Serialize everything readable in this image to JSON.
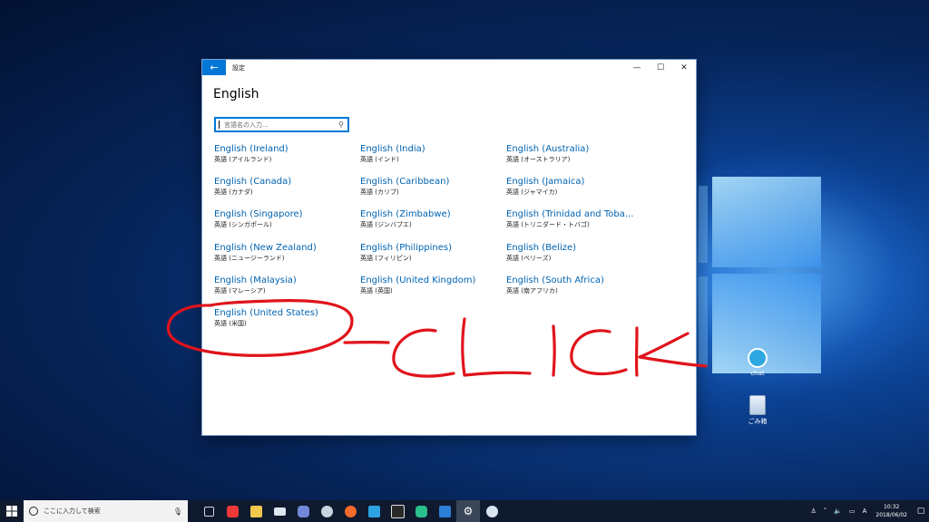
{
  "window": {
    "app_title": "設定",
    "page_title": "English",
    "back_icon": "←",
    "minimize_icon": "—",
    "maximize_icon": "☐",
    "close_icon": "✕"
  },
  "search": {
    "placeholder": "言語名の入力..."
  },
  "languages": [
    {
      "name": "English (Ireland)",
      "native": "英語 (アイルランド)"
    },
    {
      "name": "English (India)",
      "native": "英語 (インド)"
    },
    {
      "name": "English (Australia)",
      "native": "英語 (オーストラリア)"
    },
    {
      "name": "English (Canada)",
      "native": "英語 (カナダ)"
    },
    {
      "name": "English (Caribbean)",
      "native": "英語 (カリブ)"
    },
    {
      "name": "English (Jamaica)",
      "native": "英語 (ジャマイカ)"
    },
    {
      "name": "English (Singapore)",
      "native": "英語 (シンガポール)"
    },
    {
      "name": "English (Zimbabwe)",
      "native": "英語 (ジンバブエ)"
    },
    {
      "name": "English (Trinidad and Toba...",
      "native": "英語 (トリニダード・トバゴ)"
    },
    {
      "name": "English (New Zealand)",
      "native": "英語 (ニュージーランド)"
    },
    {
      "name": "English (Philippines)",
      "native": "英語 (フィリピン)"
    },
    {
      "name": "English (Belize)",
      "native": "英語 (ベリーズ)"
    },
    {
      "name": "English (Malaysia)",
      "native": "英語 (マレーシア)"
    },
    {
      "name": "English (United Kingdom)",
      "native": "英語 (英国)"
    },
    {
      "name": "English (South Africa)",
      "native": "英語 (南アフリカ)"
    },
    {
      "name": "English (United States)",
      "native": "英語 (米国)"
    }
  ],
  "annotation": {
    "color": "#e0131b",
    "text": "-CLICK"
  },
  "desktop": {
    "icons": [
      {
        "label": "chat",
        "icon": "chat-bubble-icon"
      },
      {
        "label": "ごみ箱",
        "icon": "recycle-bin-icon"
      }
    ]
  },
  "taskbar": {
    "search_placeholder": "ここに入力して検索",
    "apps": [
      {
        "icon": "task-view-icon",
        "color": "#cfd8e3"
      },
      {
        "icon": "vivaldi-icon",
        "color": "#ef3939"
      },
      {
        "icon": "file-explorer-icon",
        "color": "#f2c94c"
      },
      {
        "icon": "mail-icon",
        "color": "#dfe6ee"
      },
      {
        "icon": "discord-icon",
        "color": "#7289da"
      },
      {
        "icon": "steam-icon",
        "color": "#1b2838"
      },
      {
        "icon": "origin-icon",
        "color": "#f56c2d"
      },
      {
        "icon": "app-blue-icon",
        "color": "#2aa3e0"
      },
      {
        "icon": "epic-games-icon",
        "color": "#2a2a2a"
      },
      {
        "icon": "chat-app-icon",
        "color": "#2bbf8e"
      },
      {
        "icon": "amazon-icon",
        "color": "#2b7fd8"
      },
      {
        "icon": "settings-gear-icon",
        "color": "#e0e0e0"
      },
      {
        "icon": "paint-icon",
        "color": "#d8e4f0"
      }
    ],
    "tray_ime": "A",
    "time": "10:32",
    "date": "2018/06/02"
  }
}
